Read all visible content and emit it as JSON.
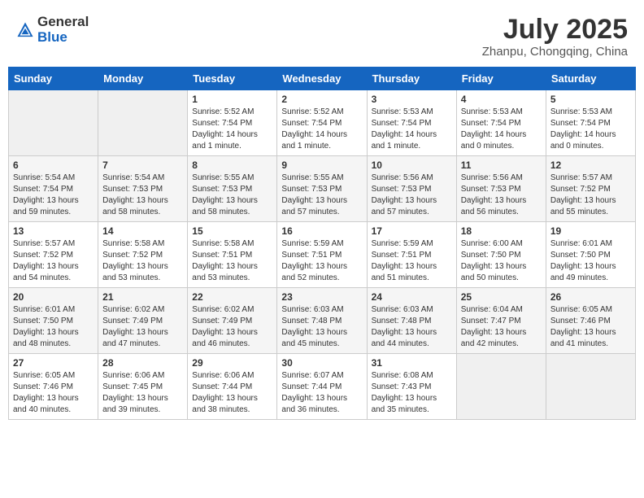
{
  "header": {
    "logo_general": "General",
    "logo_blue": "Blue",
    "month_year": "July 2025",
    "location": "Zhanpu, Chongqing, China"
  },
  "weekdays": [
    "Sunday",
    "Monday",
    "Tuesday",
    "Wednesday",
    "Thursday",
    "Friday",
    "Saturday"
  ],
  "weeks": [
    [
      {
        "day": "",
        "info": ""
      },
      {
        "day": "",
        "info": ""
      },
      {
        "day": "1",
        "info": "Sunrise: 5:52 AM\nSunset: 7:54 PM\nDaylight: 14 hours and 1 minute."
      },
      {
        "day": "2",
        "info": "Sunrise: 5:52 AM\nSunset: 7:54 PM\nDaylight: 14 hours and 1 minute."
      },
      {
        "day": "3",
        "info": "Sunrise: 5:53 AM\nSunset: 7:54 PM\nDaylight: 14 hours and 1 minute."
      },
      {
        "day": "4",
        "info": "Sunrise: 5:53 AM\nSunset: 7:54 PM\nDaylight: 14 hours and 0 minutes."
      },
      {
        "day": "5",
        "info": "Sunrise: 5:53 AM\nSunset: 7:54 PM\nDaylight: 14 hours and 0 minutes."
      }
    ],
    [
      {
        "day": "6",
        "info": "Sunrise: 5:54 AM\nSunset: 7:54 PM\nDaylight: 13 hours and 59 minutes."
      },
      {
        "day": "7",
        "info": "Sunrise: 5:54 AM\nSunset: 7:53 PM\nDaylight: 13 hours and 58 minutes."
      },
      {
        "day": "8",
        "info": "Sunrise: 5:55 AM\nSunset: 7:53 PM\nDaylight: 13 hours and 58 minutes."
      },
      {
        "day": "9",
        "info": "Sunrise: 5:55 AM\nSunset: 7:53 PM\nDaylight: 13 hours and 57 minutes."
      },
      {
        "day": "10",
        "info": "Sunrise: 5:56 AM\nSunset: 7:53 PM\nDaylight: 13 hours and 57 minutes."
      },
      {
        "day": "11",
        "info": "Sunrise: 5:56 AM\nSunset: 7:53 PM\nDaylight: 13 hours and 56 minutes."
      },
      {
        "day": "12",
        "info": "Sunrise: 5:57 AM\nSunset: 7:52 PM\nDaylight: 13 hours and 55 minutes."
      }
    ],
    [
      {
        "day": "13",
        "info": "Sunrise: 5:57 AM\nSunset: 7:52 PM\nDaylight: 13 hours and 54 minutes."
      },
      {
        "day": "14",
        "info": "Sunrise: 5:58 AM\nSunset: 7:52 PM\nDaylight: 13 hours and 53 minutes."
      },
      {
        "day": "15",
        "info": "Sunrise: 5:58 AM\nSunset: 7:51 PM\nDaylight: 13 hours and 53 minutes."
      },
      {
        "day": "16",
        "info": "Sunrise: 5:59 AM\nSunset: 7:51 PM\nDaylight: 13 hours and 52 minutes."
      },
      {
        "day": "17",
        "info": "Sunrise: 5:59 AM\nSunset: 7:51 PM\nDaylight: 13 hours and 51 minutes."
      },
      {
        "day": "18",
        "info": "Sunrise: 6:00 AM\nSunset: 7:50 PM\nDaylight: 13 hours and 50 minutes."
      },
      {
        "day": "19",
        "info": "Sunrise: 6:01 AM\nSunset: 7:50 PM\nDaylight: 13 hours and 49 minutes."
      }
    ],
    [
      {
        "day": "20",
        "info": "Sunrise: 6:01 AM\nSunset: 7:50 PM\nDaylight: 13 hours and 48 minutes."
      },
      {
        "day": "21",
        "info": "Sunrise: 6:02 AM\nSunset: 7:49 PM\nDaylight: 13 hours and 47 minutes."
      },
      {
        "day": "22",
        "info": "Sunrise: 6:02 AM\nSunset: 7:49 PM\nDaylight: 13 hours and 46 minutes."
      },
      {
        "day": "23",
        "info": "Sunrise: 6:03 AM\nSunset: 7:48 PM\nDaylight: 13 hours and 45 minutes."
      },
      {
        "day": "24",
        "info": "Sunrise: 6:03 AM\nSunset: 7:48 PM\nDaylight: 13 hours and 44 minutes."
      },
      {
        "day": "25",
        "info": "Sunrise: 6:04 AM\nSunset: 7:47 PM\nDaylight: 13 hours and 42 minutes."
      },
      {
        "day": "26",
        "info": "Sunrise: 6:05 AM\nSunset: 7:46 PM\nDaylight: 13 hours and 41 minutes."
      }
    ],
    [
      {
        "day": "27",
        "info": "Sunrise: 6:05 AM\nSunset: 7:46 PM\nDaylight: 13 hours and 40 minutes."
      },
      {
        "day": "28",
        "info": "Sunrise: 6:06 AM\nSunset: 7:45 PM\nDaylight: 13 hours and 39 minutes."
      },
      {
        "day": "29",
        "info": "Sunrise: 6:06 AM\nSunset: 7:44 PM\nDaylight: 13 hours and 38 minutes."
      },
      {
        "day": "30",
        "info": "Sunrise: 6:07 AM\nSunset: 7:44 PM\nDaylight: 13 hours and 36 minutes."
      },
      {
        "day": "31",
        "info": "Sunrise: 6:08 AM\nSunset: 7:43 PM\nDaylight: 13 hours and 35 minutes."
      },
      {
        "day": "",
        "info": ""
      },
      {
        "day": "",
        "info": ""
      }
    ]
  ]
}
